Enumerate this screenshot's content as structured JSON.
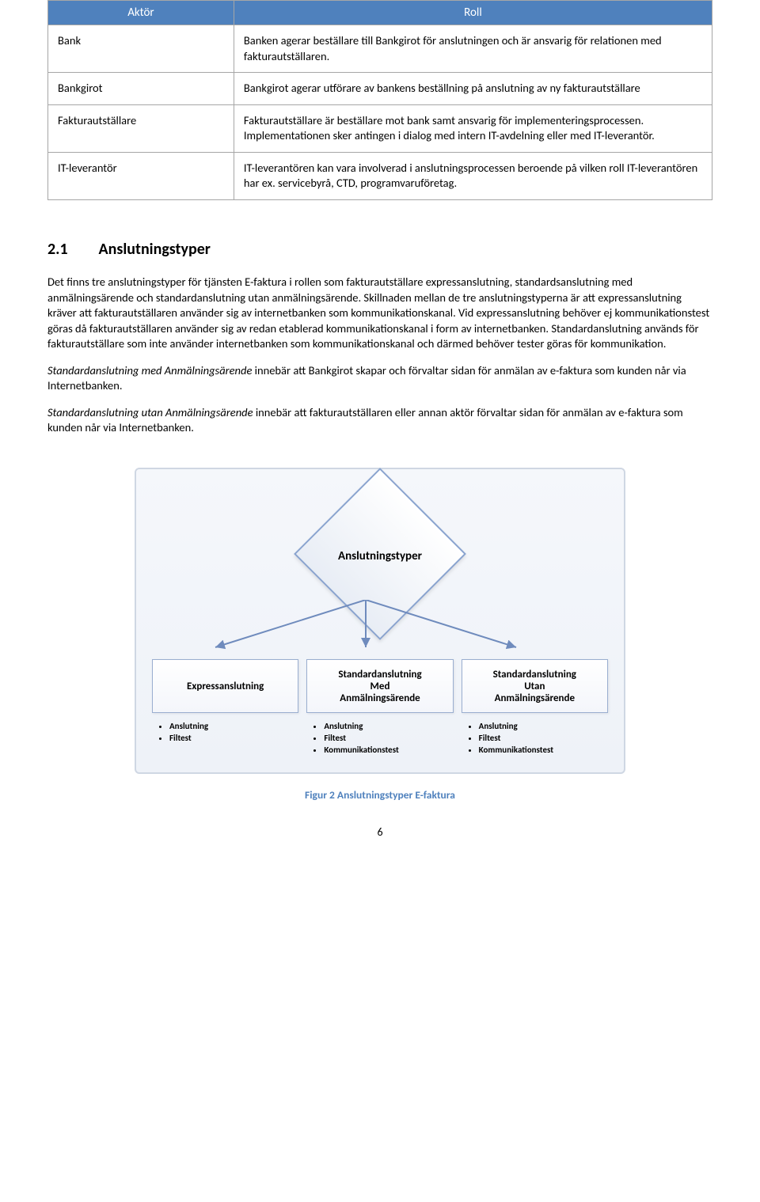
{
  "table": {
    "head": {
      "col1": "Aktör",
      "col2": "Roll"
    },
    "rows": [
      {
        "actor": "Bank",
        "role": "Banken agerar beställare till Bankgirot för anslutningen och är ansvarig för relationen med fakturautställaren."
      },
      {
        "actor": "Bankgirot",
        "role": "Bankgirot agerar utförare av bankens beställning på anslutning av ny fakturautställare"
      },
      {
        "actor": "Fakturautställare",
        "role": "Fakturautställare är beställare mot bank samt ansvarig för implementeringsprocessen. Implementationen sker antingen i dialog med intern IT-avdelning eller med IT-leverantör."
      },
      {
        "actor": "IT-leverantör",
        "role": "IT-leverantören kan vara involverad i anslutningsprocessen beroende på vilken roll IT-leverantören har ex. servicebyrå, CTD, programvaruföretag."
      }
    ]
  },
  "section": {
    "num": "2.1",
    "title": "Anslutningstyper"
  },
  "para1": "Det finns tre anslutningstyper för tjänsten E-faktura i rollen som fakturautställare expressanslutning, standardsanslutning med anmälningsärende och standardanslutning utan anmälningsärende. Skillnaden mellan de tre anslutningstyperna är att expressanslutning kräver att fakturautställaren använder sig av internetbanken som kommunikationskanal. Vid expressanslutning behöver ej kommunikationstest göras då fakturautställaren använder sig av redan etablerad kommunikationskanal i form av internetbanken. Standardanslutning används för fakturautställare som inte använder internetbanken som kommunikationskanal och därmed behöver tester göras för kommunikation.",
  "para2_lead": "Standardanslutning med Anmälningsärende",
  "para2_rest": " innebär att Bankgirot skapar och förvaltar sidan för anmälan av e-faktura som kunden når via Internetbanken.",
  "para3_lead": "Standardanslutning utan Anmälningsärende",
  "para3_rest": " innebär att fakturautställaren eller annan aktör förvaltar sidan för anmälan av e-faktura som kunden når via Internetbanken.",
  "diagram": {
    "decision": "Anslutningstyper",
    "branches": [
      {
        "title": "Expressanslutning",
        "bullets": [
          "Anslutning",
          "Filtest"
        ]
      },
      {
        "title": "Standardanslutning\nMed\nAnmälningsärende",
        "bullets": [
          "Anslutning",
          "Filtest",
          "Kommunikationstest"
        ]
      },
      {
        "title": "Standardanslutning\nUtan\nAnmälningsärende",
        "bullets": [
          "Anslutning",
          "Filtest",
          "Kommunikationstest"
        ]
      }
    ],
    "caption": "Figur 2 Anslutningstyper E-faktura"
  },
  "pagenum": "6"
}
